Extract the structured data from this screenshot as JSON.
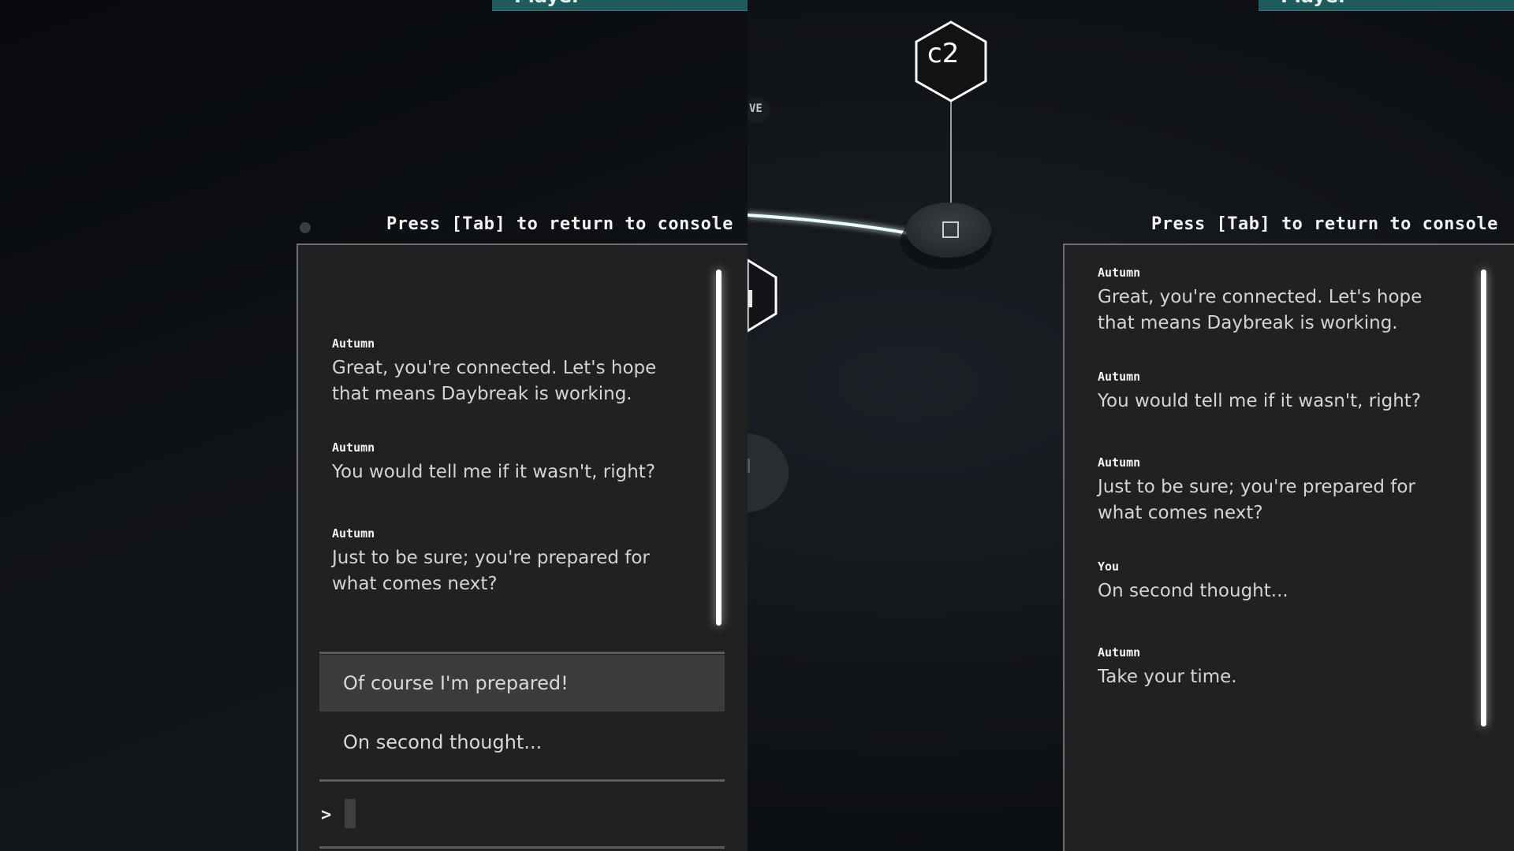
{
  "left_view": {
    "player_tab": "Player",
    "hint": "Press [Tab] to return to console",
    "messages": [
      {
        "speaker": "Autumn",
        "text": "Great, you're connected. Let's hope that means Daybreak is working."
      },
      {
        "speaker": "Autumn",
        "text": "You would tell me if it wasn't, right?"
      },
      {
        "speaker": "Autumn",
        "text": "Just to be sure; you're prepared for what comes next?"
      }
    ],
    "choices": [
      "Of course I'm prepared!",
      "On second thought..."
    ],
    "prompt_symbol": ">"
  },
  "right_view": {
    "player_tab": "Player",
    "hint": "Press [Tab] to return to console",
    "messages": [
      {
        "speaker": "Autumn",
        "text": "Great, you're connected. Let's hope that means Daybreak is working."
      },
      {
        "speaker": "Autumn",
        "text": "You would tell me if it wasn't, right?"
      },
      {
        "speaker": "Autumn",
        "text": "Just to be sure; you're prepared for what comes next?"
      },
      {
        "speaker": "You",
        "text": "On second thought..."
      },
      {
        "speaker": "Autumn",
        "text": "Take your time."
      }
    ]
  },
  "scene": {
    "node_label": "c2",
    "partial_tag": "VE"
  },
  "colors": {
    "panel_bg": "#202122",
    "selected_choice": "#3a3b3d",
    "player_tab": "#1f5a5c",
    "glow": "#ffffff"
  }
}
